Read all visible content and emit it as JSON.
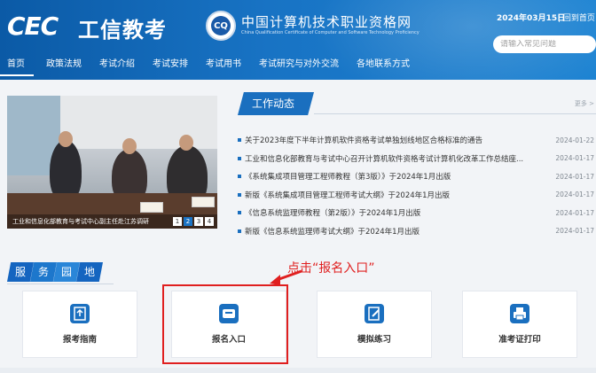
{
  "header": {
    "logo_cec": "CEC",
    "logo_cn": "工信教考",
    "emblem_text": "CQ",
    "site_title": "中国计算机技术职业资格网",
    "site_subtitle": "China Qualification Certificate of Computer and Software Technology Proficiency",
    "date": "2024年03月15日",
    "home_link": "| 回到首页",
    "search_placeholder": "请输入常见问题"
  },
  "nav": {
    "items": [
      {
        "label": "首页"
      },
      {
        "label": "政策法规"
      },
      {
        "label": "考试介绍"
      },
      {
        "label": "考试安排"
      },
      {
        "label": "考试用书"
      },
      {
        "label": "考试研究与对外交流"
      },
      {
        "label": "各地联系方式"
      }
    ]
  },
  "banner": {
    "caption": "工业和信息化部教育与考试中心副主任赴江苏调研",
    "pages": [
      "1",
      "2",
      "3",
      "4"
    ],
    "active_page": "2"
  },
  "news": {
    "section_title": "工作动态",
    "more_label": "更多 >",
    "items": [
      {
        "title": "关于2023年度下半年计算机软件资格考试单独划线地区合格标准的通告",
        "date": "2024-01-22"
      },
      {
        "title": "工业和信息化部教育与考试中心召开计算机软件资格考试计算机化改革工作总结座...",
        "date": "2024-01-17"
      },
      {
        "title": "《系统集成项目管理工程师教程（第3版）》于2024年1月出版",
        "date": "2024-01-17"
      },
      {
        "title": "新版《系统集成项目管理工程师考试大纲》于2024年1月出版",
        "date": "2024-01-17"
      },
      {
        "title": "《信息系统监理师教程（第2版）》于2024年1月出版",
        "date": "2024-01-17"
      },
      {
        "title": "新版《信息系统监理师考试大纲》于2024年1月出版",
        "date": "2024-01-17"
      }
    ]
  },
  "service": {
    "chars": [
      "服",
      "务",
      "园",
      "地"
    ],
    "annotation": "点击“报名入口”",
    "cards": [
      {
        "label": "报考指南"
      },
      {
        "label": "报名入口"
      },
      {
        "label": "模拟练习"
      },
      {
        "label": "准考证打印"
      }
    ]
  },
  "colors": {
    "brand_blue": "#1a6fbf",
    "header_blue": "#0b5aa6",
    "annotation_red": "#e01f1f"
  }
}
